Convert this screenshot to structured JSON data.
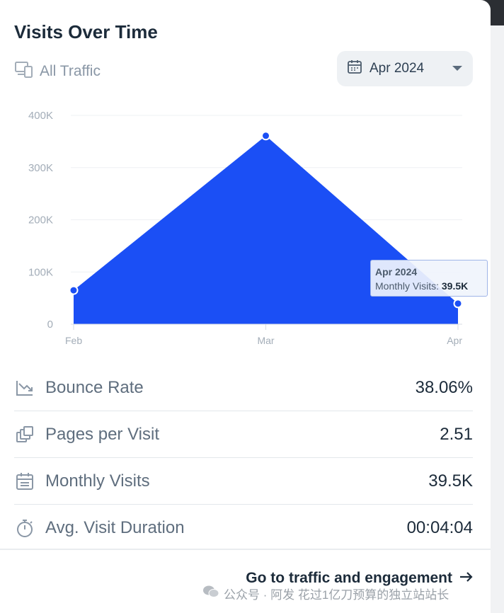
{
  "widget": {
    "title": "Visits Over Time",
    "filter_label": "All Traffic",
    "date_selector": "Apr 2024"
  },
  "chart_data": {
    "type": "area",
    "title": "",
    "xlabel": "",
    "ylabel": "",
    "x": [
      "Feb",
      "Mar",
      "Apr"
    ],
    "values": [
      65000,
      361000,
      39500
    ],
    "ylim": [
      0,
      400000
    ],
    "y_ticks": [
      "0",
      "100K",
      "200K",
      "300K",
      "400K"
    ],
    "grid": true,
    "color": "#1b4ff5",
    "tooltip": {
      "title": "Apr 2024",
      "label": "Monthly Visits:",
      "value": "39.5K"
    }
  },
  "metrics": [
    {
      "label": "Bounce Rate",
      "value": "38.06%",
      "icon": "trend-down-icon"
    },
    {
      "label": "Pages per Visit",
      "value": "2.51",
      "icon": "pages-icon"
    },
    {
      "label": "Monthly Visits",
      "value": "39.5K",
      "icon": "calendar-icon"
    },
    {
      "label": "Avg. Visit Duration",
      "value": "00:04:04",
      "icon": "stopwatch-icon"
    }
  ],
  "cta_label": "Go to traffic and engagement",
  "watermark": "公众号 · 阿发 花过1亿刀预算的独立站站长"
}
